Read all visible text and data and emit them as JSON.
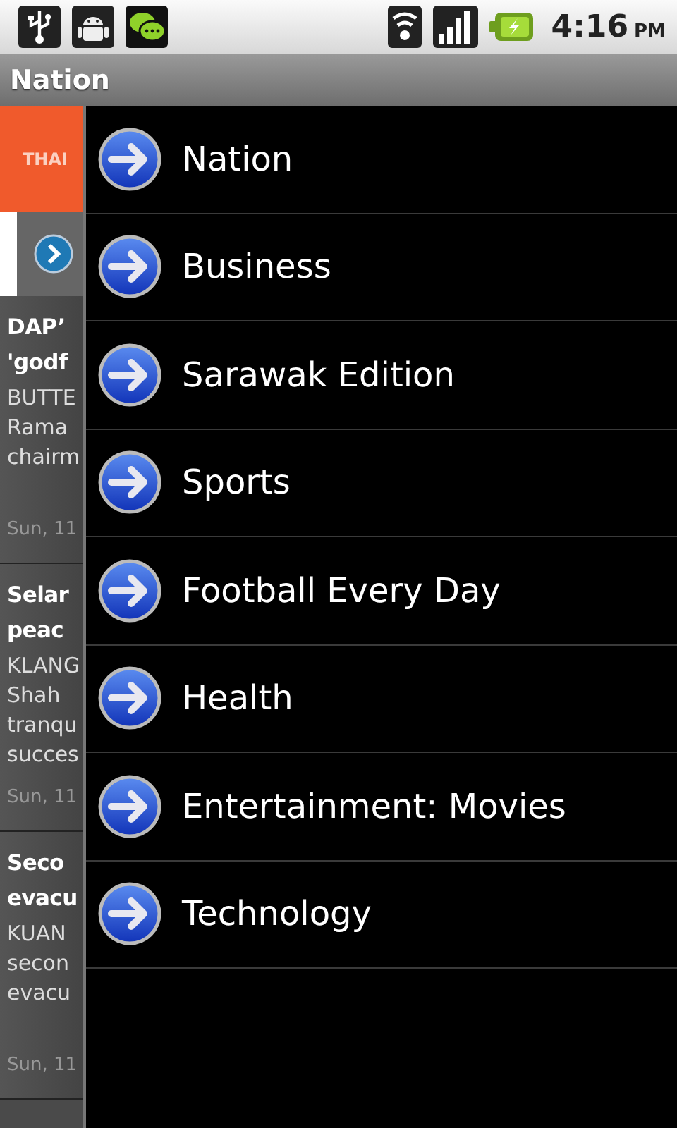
{
  "status_bar": {
    "time": "4:16",
    "am_pm": "PM"
  },
  "title_bar": {
    "title": "Nation"
  },
  "background": {
    "banner": "THAI",
    "articles": [
      {
        "title_lines": [
          "DAP’",
          "'godf"
        ],
        "summary_lines": [
          "BUTTE",
          "Rama",
          "chairm"
        ],
        "date": "Sun, 11"
      },
      {
        "title_lines": [
          "Selar",
          "peac"
        ],
        "summary_lines": [
          "KLANG",
          "Shah",
          "tranqu",
          "succes"
        ],
        "date": "Sun, 11"
      },
      {
        "title_lines": [
          "Seco",
          "evacu"
        ],
        "summary_lines": [
          "KUAN",
          "secon",
          "evacu"
        ],
        "date": "Sun, 11"
      }
    ]
  },
  "menu": {
    "items": [
      {
        "label": "Nation"
      },
      {
        "label": "Business"
      },
      {
        "label": "Sarawak Edition"
      },
      {
        "label": "Sports"
      },
      {
        "label": "Football Every Day"
      },
      {
        "label": "Health"
      },
      {
        "label": "Entertainment: Movies"
      },
      {
        "label": "Technology"
      }
    ]
  }
}
